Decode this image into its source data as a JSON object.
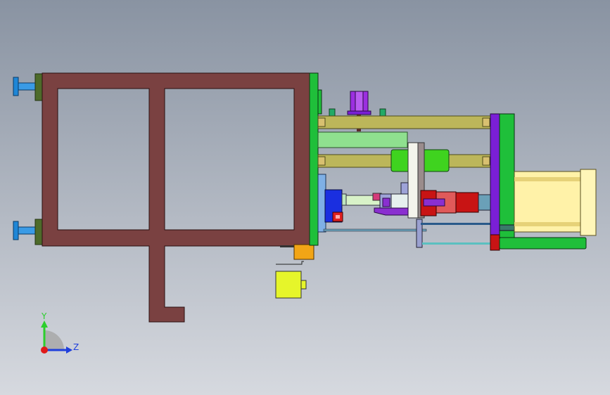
{
  "viewport": {
    "background_top": "#8993a2",
    "background_bottom": "#d6d9df"
  },
  "model": {
    "frame_color": "#7a4141",
    "plate_green": "#1fbf3a",
    "plate_purple": "#7a1fd6",
    "rod_color": "#bcb65a",
    "cylinder_color": "#fff2a8",
    "accent_red": "#c81414",
    "accent_blue": "#1a2fe0",
    "accent_yellow": "#e6f52a",
    "accent_orange": "#f2a516",
    "leveling_feet_color": "#1f86d6"
  },
  "triad": {
    "y_label": "Y",
    "z_label": "Z",
    "y_color": "#2ccf2c",
    "z_color": "#1f3fdc",
    "origin_color": "#e01a1a"
  }
}
